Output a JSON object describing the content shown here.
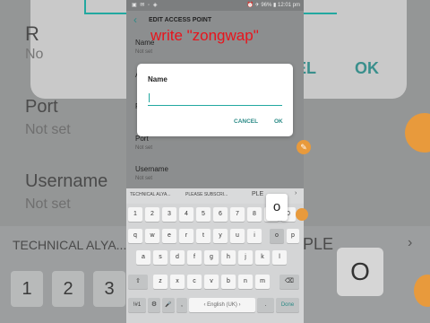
{
  "background": {
    "rows_partial": "R",
    "no_partial": "No",
    "cancel_partial": "EL",
    "ok": "OK",
    "port_label": "Port",
    "port_value": "Not set",
    "username_label": "Username",
    "username_value": "Not set",
    "suggestion": "TECHNICAL ALYA...",
    "suggestion_right": "PLE",
    "chevron": "›",
    "keys": [
      "1",
      "2",
      "3"
    ],
    "big_key": "O"
  },
  "status": {
    "icons": "▣ ✉ ◦ ◈",
    "right": "⏰ ✈ 96% ▮ 12:01 pm"
  },
  "appbar": {
    "back": "‹",
    "title": "EDIT ACCESS POINT"
  },
  "fields": [
    {
      "label": "Name",
      "value": "Not set"
    },
    {
      "label": "A",
      "value": ""
    },
    {
      "label": "P",
      "value": ""
    },
    {
      "label": "Port",
      "value": "Not set"
    },
    {
      "label": "Username",
      "value": "Not set"
    }
  ],
  "overlay_text": "write \"zongwap\"",
  "dialog": {
    "title": "Name",
    "input_value": "",
    "cancel": "CANCEL",
    "ok": "OK"
  },
  "keyboard": {
    "suggestions": [
      "TECHNICAL ALYA...",
      "PLEASE SUBSCRI..."
    ],
    "suggestion_right": "PLE",
    "suggestion_chevron": "›",
    "popup_key": "o",
    "row_numbers": [
      "1",
      "2",
      "3",
      "4",
      "5",
      "6",
      "7",
      "8",
      "9",
      "0"
    ],
    "row1": [
      "q",
      "w",
      "e",
      "r",
      "t",
      "y",
      "u",
      "i",
      "o",
      "p"
    ],
    "row2": [
      "a",
      "s",
      "d",
      "f",
      "g",
      "h",
      "j",
      "k",
      "l"
    ],
    "row3": [
      "⇧",
      "z",
      "x",
      "c",
      "v",
      "b",
      "n",
      "m",
      "⌫"
    ],
    "row4": {
      "sym": "!#1",
      "settings": "⚙",
      "mic": "🎤",
      "comma": ",",
      "space": "‹ English (UK) ›",
      "period": ".",
      "done": "Done"
    }
  },
  "colors": {
    "accent": "#22a8a0",
    "overlay_red": "#e8141c",
    "fab_orange": "#e89a3c"
  }
}
